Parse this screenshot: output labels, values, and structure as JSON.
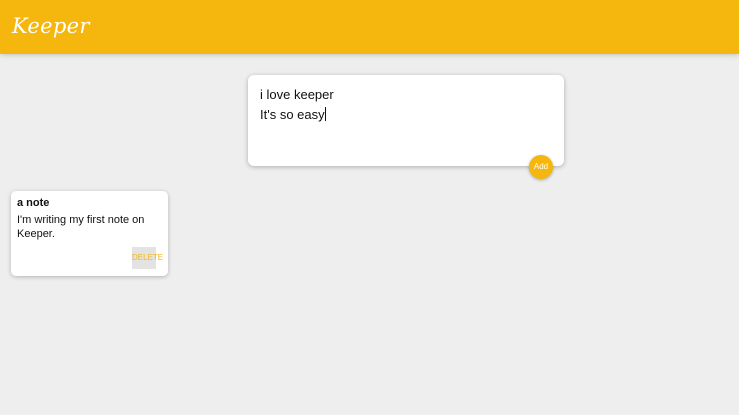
{
  "header": {
    "app_name": "Keeper"
  },
  "create_note": {
    "title_value": "i love keeper",
    "content_value": "It's so easy",
    "add_label": "Add"
  },
  "notes": [
    {
      "title": "a note",
      "content": "I'm writing my first note on Keeper.",
      "delete_label": "DELETE"
    }
  ],
  "colors": {
    "accent": "#f5b60d",
    "background": "#eeeeee",
    "card": "#ffffff"
  }
}
